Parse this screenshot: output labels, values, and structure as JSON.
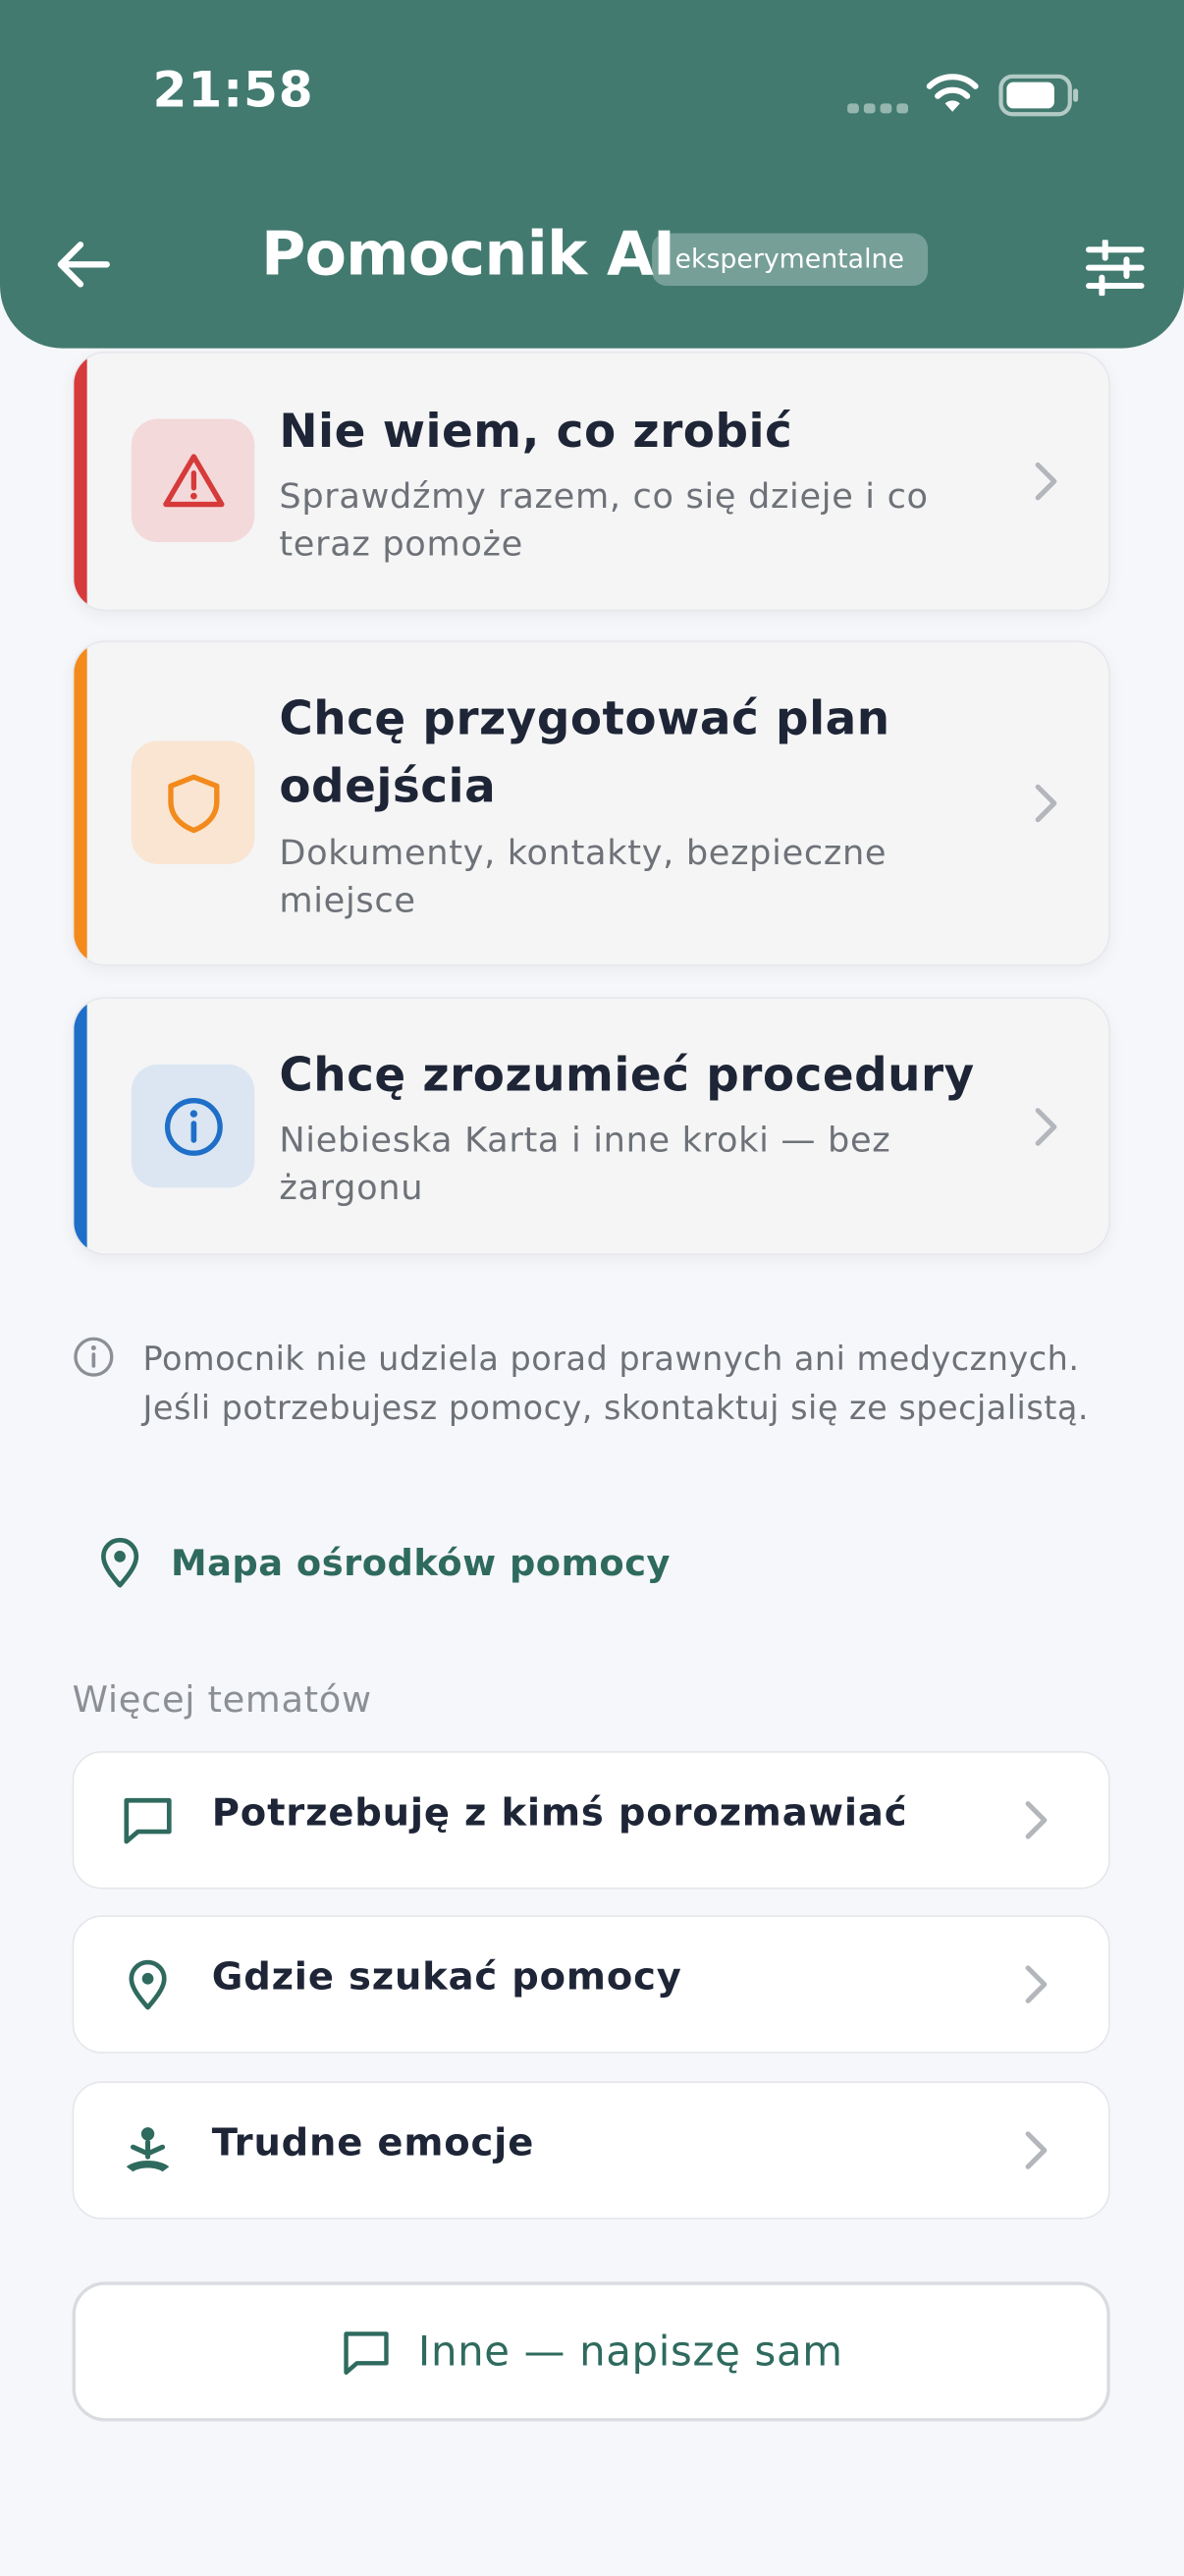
{
  "status_bar": {
    "time": "21:58",
    "icons": [
      "signal-icon",
      "wifi-icon",
      "battery-icon"
    ]
  },
  "header": {
    "title": "Pomocnik AI",
    "badge": "eksperymentalne",
    "back_icon": "arrow-left-icon",
    "settings_icon": "sliders-icon",
    "background": "#427a6f"
  },
  "main_cards": [
    {
      "title": "Nie wiem, co zrobić",
      "description": "Sprawdźmy razem, co się dzieje i co teraz pomoże",
      "icon": "warning-icon",
      "accent": "#d63a3a"
    },
    {
      "title": "Chcę przygotować plan odejścia",
      "description": "Dokumenty, kontakty, bezpieczne miejsce",
      "icon": "shield-icon",
      "accent": "#f28a1c"
    },
    {
      "title": "Chcę zrozumieć procedury",
      "description": "Niebieska Karta i inne kroki — bez żargonu",
      "icon": "info-icon",
      "accent": "#1f6fc9"
    }
  ],
  "disclaimer": {
    "text": "Pomocnik nie udziela porad prawnych ani medycznych. Jeśli potrzebujesz pomocy, skontaktuj się ze specjalistą.",
    "icon": "info-circle-icon"
  },
  "map_link": {
    "label": "Mapa ośrodków pomocy",
    "icon": "map-pin-icon"
  },
  "more_topics": {
    "heading": "Więcej tematów",
    "items": [
      {
        "label": "Potrzebuję z kimś porozmawiać",
        "icon": "chat-bubble-icon"
      },
      {
        "label": "Gdzie szukać pomocy",
        "icon": "map-pin-icon"
      },
      {
        "label": "Trudne emocje",
        "icon": "meditation-icon"
      }
    ]
  },
  "other_button": {
    "label": "Inne — napiszę sam",
    "icon": "chat-bubble-icon"
  },
  "colors": {
    "primary": "#427a6f",
    "link": "#2f6a5e",
    "text": "#1e2536",
    "muted": "#6e7278",
    "background": "#f6f7fa"
  }
}
